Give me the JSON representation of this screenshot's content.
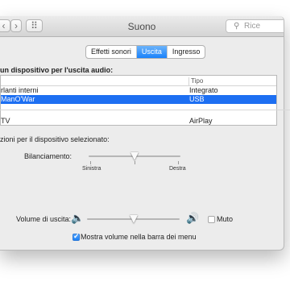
{
  "window": {
    "title": "Suono",
    "search_placeholder": "Rice"
  },
  "nav": {
    "back": "‹",
    "forward": "›",
    "grid": "⠿"
  },
  "tabs": [
    "Effetti sonori",
    "Uscita",
    "Ingresso"
  ],
  "active_tab": "Uscita",
  "output_heading": "un dispositivo per l'uscita audio:",
  "device_table": {
    "columns": [
      "",
      "Tipo"
    ],
    "rows": [
      {
        "name": "rlanti interni",
        "type": "Integrato",
        "selected": false
      },
      {
        "name": "ManO'War",
        "type": "USB",
        "selected": true
      },
      {
        "name": "TV",
        "type": "AirPlay",
        "selected": false
      }
    ]
  },
  "settings_heading": "zioni per il dispositivo selezionato:",
  "balance": {
    "label": "Bilanciamento:",
    "left_label": "Sinistra",
    "right_label": "Destra",
    "value": 0.5
  },
  "volume": {
    "label": "Volume di uscita:",
    "value": 0.5,
    "mute_label": "Muto",
    "muted": false
  },
  "menubar_checkbox": {
    "label": "Mostra volume nella barra dei menu",
    "checked": true
  }
}
